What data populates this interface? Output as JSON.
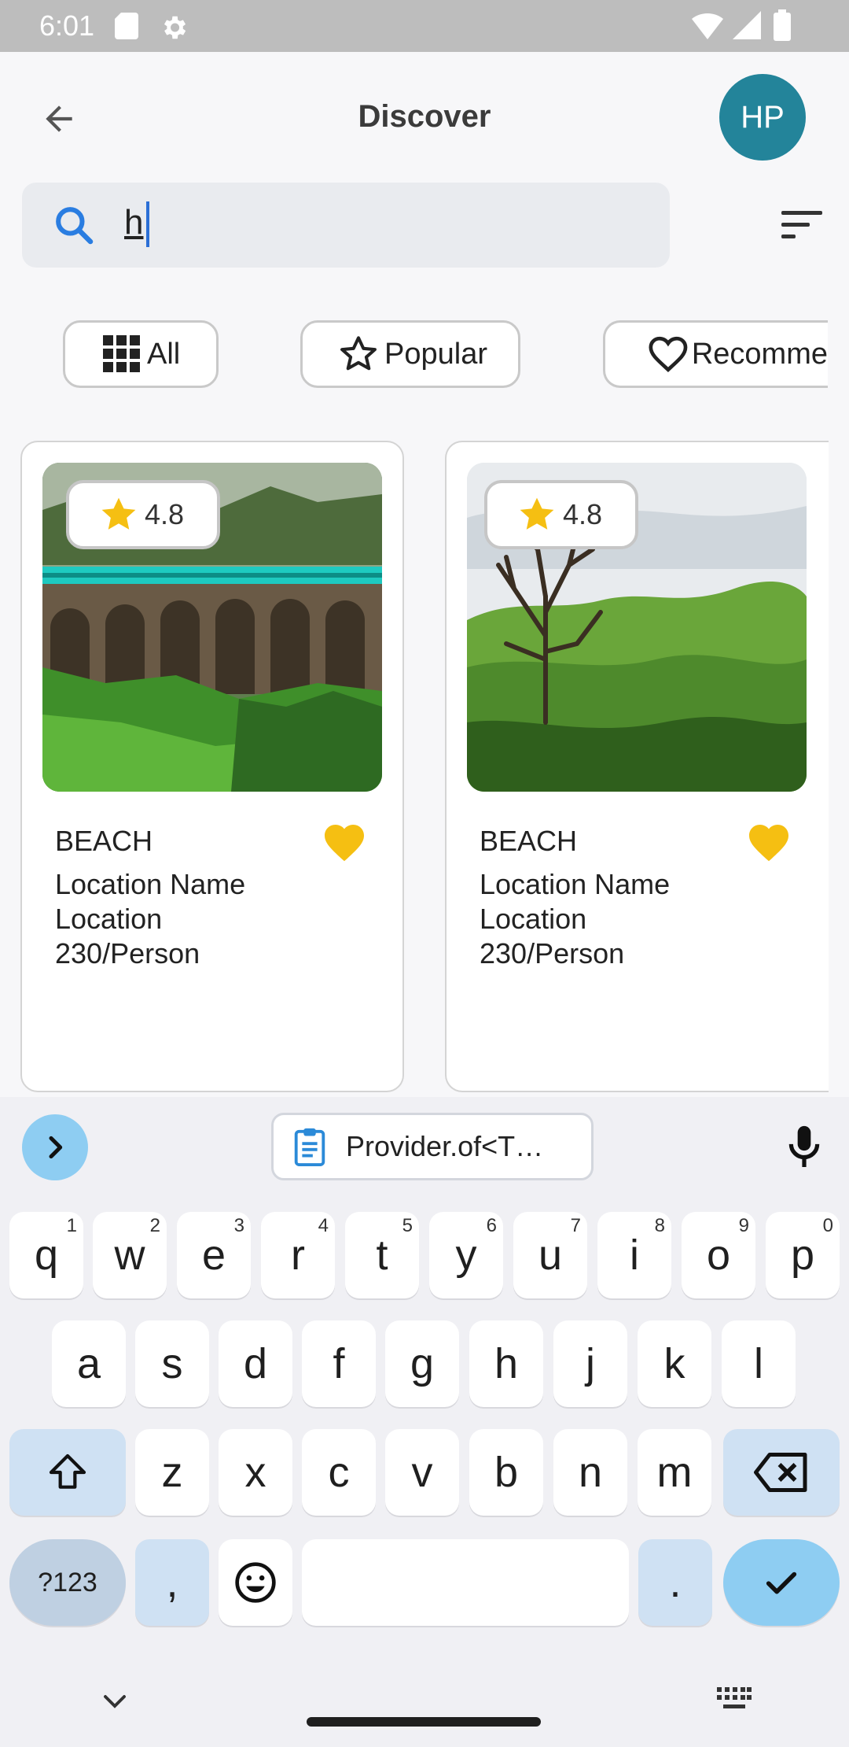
{
  "status": {
    "time": "6:01"
  },
  "header": {
    "title": "Discover",
    "avatar": "HP"
  },
  "search": {
    "value": "h"
  },
  "chips": [
    {
      "label": "All",
      "icon": "grid-icon"
    },
    {
      "label": "Popular",
      "icon": "star-outline-icon"
    },
    {
      "label": "Recomme",
      "icon": "heart-outline-icon"
    }
  ],
  "cards": [
    {
      "rating": "4.8",
      "category": "BEACH",
      "name": "Location Name",
      "location": "Location",
      "price": "230/Person"
    },
    {
      "rating": "4.8",
      "category": "BEACH",
      "name": "Location Name",
      "location": "Location",
      "price": "230/Person"
    }
  ],
  "keyboard": {
    "suggestion": "Provider.of<T…",
    "row1": [
      {
        "k": "q",
        "n": "1"
      },
      {
        "k": "w",
        "n": "2"
      },
      {
        "k": "e",
        "n": "3"
      },
      {
        "k": "r",
        "n": "4"
      },
      {
        "k": "t",
        "n": "5"
      },
      {
        "k": "y",
        "n": "6"
      },
      {
        "k": "u",
        "n": "7"
      },
      {
        "k": "i",
        "n": "8"
      },
      {
        "k": "o",
        "n": "9"
      },
      {
        "k": "p",
        "n": "0"
      }
    ],
    "row2": [
      "a",
      "s",
      "d",
      "f",
      "g",
      "h",
      "j",
      "k",
      "l"
    ],
    "row3": [
      "z",
      "x",
      "c",
      "v",
      "b",
      "n",
      "m"
    ],
    "symbols": "?123",
    "comma": ",",
    "period": "."
  },
  "colors": {
    "accent": "#23849a",
    "heart": "#f5bf12",
    "keyboard_action": "#8ecdf2"
  }
}
